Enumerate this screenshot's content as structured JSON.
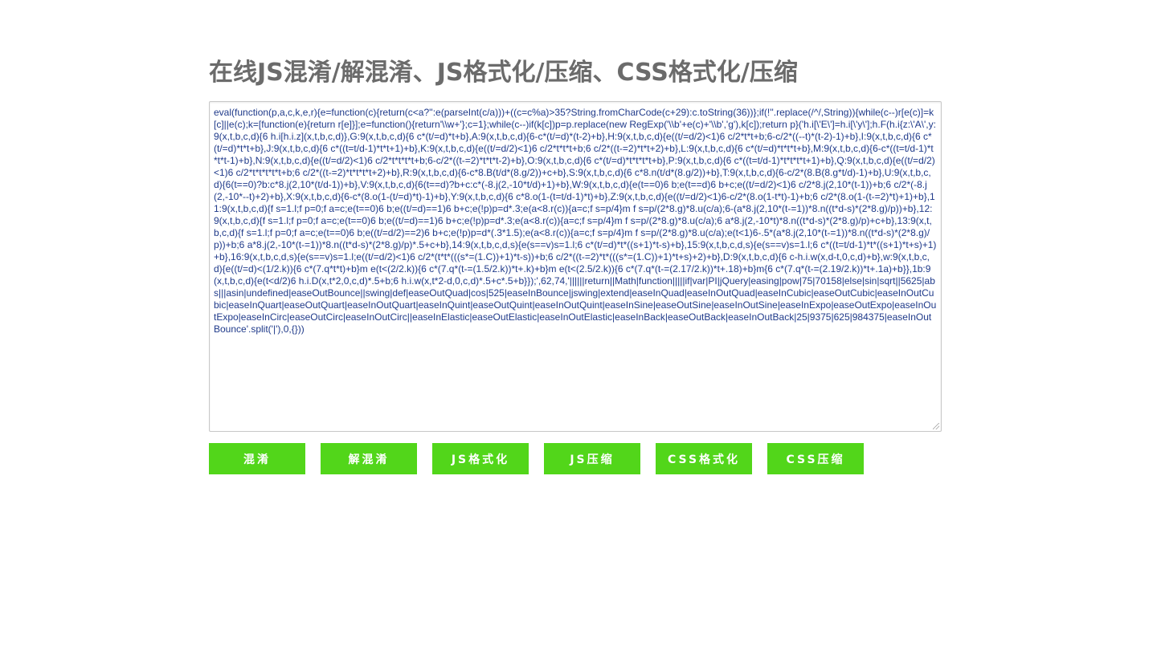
{
  "page": {
    "title": "在线JS混淆/解混淆、JS格式化/压缩、CSS格式化/压缩"
  },
  "editor": {
    "value": "eval(function(p,a,c,k,e,r){e=function(c){return(c<a?'':e(parseInt(c/a)))+((c=c%a)>35?String.fromCharCode(c+29):c.toString(36))};if(!''.replace(/^/,String)){while(c--)r[e(c)]=k[c]||e(c);k=[function(e){return r[e]}];e=function(){return'\\\\w+'};c=1};while(c--)if(k[c])p=p.replace(new RegExp('\\\\b'+e(c)+'\\\\b','g'),k[c]);return p}('h.i[\\'E\\']=h.i[\\'y\\'];h.F(h.i{z:\\'A\\',y:9(x,t,b,c,d){6 h.i[h.i.z](x,t,b,c,d)},G:9(x,t,b,c,d){6 c*(t/=d)*t+b},A:9(x,t,b,c,d){6-c*(t/=d)*(t-2)+b},H:9(x,t,b,c,d){e((t/=d/2)<1)6 c/2*t*t+b;6-c/2*((--t)*(t-2)-1)+b},I:9(x,t,b,c,d){6 c*(t/=d)*t*t+b},J:9(x,t,b,c,d){6 c*((t=t/d-1)*t*t+1)+b},K:9(x,t,b,c,d){e((t/=d/2)<1)6 c/2*t*t*t+b;6 c/2*((t-=2)*t*t+2)+b},L:9(x,t,b,c,d){6 c*(t/=d)*t*t*t+b},M:9(x,t,b,c,d){6-c*((t=t/d-1)*t*t*t-1)+b},N:9(x,t,b,c,d){e((t/=d/2)<1)6 c/2*t*t*t*t+b;6-c/2*((t-=2)*t*t*t-2)+b},O:9(x,t,b,c,d){6 c*(t/=d)*t*t*t*t+b},P:9(x,t,b,c,d){6 c*((t=t/d-1)*t*t*t*t+1)+b},Q:9(x,t,b,c,d){e((t/=d/2)<1)6 c/2*t*t*t*t*t+b;6 c/2*((t-=2)*t*t*t*t+2)+b},R:9(x,t,b,c,d){6-c*8.B(t/d*(8.g/2))+c+b},S:9(x,t,b,c,d){6 c*8.n(t/d*(8.g/2))+b},T:9(x,t,b,c,d){6-c/2*(8.B(8.g*t/d)-1)+b},U:9(x,t,b,c,d){6(t==0)?b:c*8.j(2,10*(t/d-1))+b},V:9(x,t,b,c,d){6(t==d)?b+c:c*(-8.j(2,-10*t/d)+1)+b},W:9(x,t,b,c,d){e(t==0)6 b;e(t==d)6 b+c;e((t/=d/2)<1)6 c/2*8.j(2,10*(t-1))+b;6 c/2*(-8.j(2,-10*--t)+2)+b},X:9(x,t,b,c,d){6-c*(8.o(1-(t/=d)*t)-1)+b},Y:9(x,t,b,c,d){6 c*8.o(1-(t=t/d-1)*t)+b},Z:9(x,t,b,c,d){e((t/=d/2)<1)6-c/2*(8.o(1-t*t)-1)+b;6 c/2*(8.o(1-(t-=2)*t)+1)+b},11:9(x,t,b,c,d){f s=1.l;f p=0;f a=c;e(t==0)6 b;e((t/=d)==1)6 b+c;e(!p)p=d*.3;e(a<8.r(c)){a=c;f s=p/4}m f s=p/(2*8.g)*8.u(c/a);6-(a*8.j(2,10*(t-=1))*8.n((t*d-s)*(2*8.g)/p))+b},12:9(x,t,b,c,d){f s=1.l;f p=0;f a=c;e(t==0)6 b;e((t/=d)==1)6 b+c;e(!p)p=d*.3;e(a<8.r(c)){a=c;f s=p/4}m f s=p/(2*8.g)*8.u(c/a);6 a*8.j(2,-10*t)*8.n((t*d-s)*(2*8.g)/p)+c+b},13:9(x,t,b,c,d){f s=1.l;f p=0;f a=c;e(t==0)6 b;e((t/=d/2)==2)6 b+c;e(!p)p=d*(.3*1.5);e(a<8.r(c)){a=c;f s=p/4}m f s=p/(2*8.g)*8.u(c/a);e(t<1)6-.5*(a*8.j(2,10*(t-=1))*8.n((t*d-s)*(2*8.g)/p))+b;6 a*8.j(2,-10*(t-=1))*8.n((t*d-s)*(2*8.g)/p)*.5+c+b},14:9(x,t,b,c,d,s){e(s==v)s=1.l;6 c*(t/=d)*t*((s+1)*t-s)+b},15:9(x,t,b,c,d,s){e(s==v)s=1.l;6 c*((t=t/d-1)*t*((s+1)*t+s)+1)+b},16:9(x,t,b,c,d,s){e(s==v)s=1.l;e((t/=d/2)<1)6 c/2*(t*t*(((s*=(1.C))+1)*t-s))+b;6 c/2*((t-=2)*t*(((s*=(1.C))+1)*t+s)+2)+b},D:9(x,t,b,c,d){6 c-h.i.w(x,d-t,0,c,d)+b},w:9(x,t,b,c,d){e((t/=d)<(1/2.k)){6 c*(7.q*t*t)+b}m e(t<(2/2.k)){6 c*(7.q*(t-=(1.5/2.k))*t+.k)+b}m e(t<(2.5/2.k)){6 c*(7.q*(t-=(2.17/2.k))*t+.18)+b}m{6 c*(7.q*(t-=(2.19/2.k))*t+.1a)+b}},1b:9(x,t,b,c,d){e(t<d/2)6 h.i.D(x,t*2,0,c,d)*.5+b;6 h.i.w(x,t*2-d,0,c,d)*.5+c*.5+b}});',62,74,'||||||return||Math|function|||||if|var|PI|jQuery|easing|pow|75|70158|else|sin|sqrt||5625|abs|||asin|undefined|easeOutBounce||swing|def|easeOutQuad|cos|525|easeInBounce|jswing|extend|easeInQuad|easeInOutQuad|easeInCubic|easeOutCubic|easeInOutCubic|easeInQuart|easeOutQuart|easeInOutQuart|easeInQuint|easeOutQuint|easeInOutQuint|easeInSine|easeOutSine|easeInOutSine|easeInExpo|easeOutExpo|easeInOutExpo|easeInCirc|easeOutCirc|easeInOutCirc||easeInElastic|easeOutElastic|easeInOutElastic|easeInBack|easeOutBack|easeInOutBack|25|9375|625|984375|easeInOutBounce'.split('|'),0,{}))"
  },
  "toolbar": {
    "obfuscate_label": "混淆",
    "deobfuscate_label": "解混淆",
    "js_format_label": "JS格式化",
    "js_compress_label": "JS压缩",
    "css_format_label": "CSS格式化",
    "css_compress_label": "CSS压缩"
  },
  "colors": {
    "button_bg": "#52d61a",
    "button_text": "#ffffff",
    "title": "#6b6b6b",
    "code_text": "#1f3a8a"
  }
}
